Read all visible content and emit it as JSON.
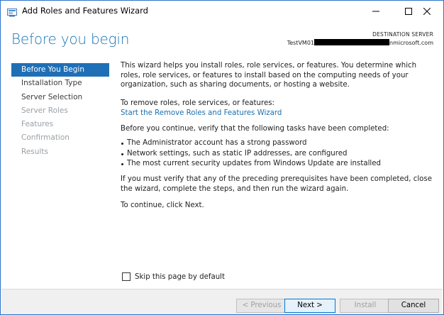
{
  "window": {
    "title": "Add Roles and Features Wizard"
  },
  "header": {
    "heading": "Before you begin",
    "destination_label": "DESTINATION SERVER",
    "destination_server_prefix": "TestVM01",
    "destination_server_suffix": "nmicrosoft.com"
  },
  "nav": {
    "items": [
      {
        "label": "Before You Begin",
        "state": "active"
      },
      {
        "label": "Installation Type",
        "state": "enabled"
      },
      {
        "label": "Server Selection",
        "state": "enabled"
      },
      {
        "label": "Server Roles",
        "state": "disabled"
      },
      {
        "label": "Features",
        "state": "disabled"
      },
      {
        "label": "Confirmation",
        "state": "disabled"
      },
      {
        "label": "Results",
        "state": "disabled"
      }
    ]
  },
  "content": {
    "intro": "This wizard helps you install roles, role services, or features. You determine which roles, role services, or features to install based on the computing needs of your organization, such as sharing documents, or hosting a website.",
    "remove_intro": "To remove roles, role services, or features:",
    "remove_link": "Start the Remove Roles and Features Wizard",
    "verify": "Before you continue, verify that the following tasks have been completed:",
    "bullets": [
      "The Administrator account has a strong password",
      "Network settings, such as static IP addresses, are configured",
      "The most current security updates from Windows Update are installed"
    ],
    "prereq": "If you must verify that any of the preceding prerequisites have been completed, close the wizard, complete the steps, and then run the wizard again.",
    "continue": "To continue, click Next."
  },
  "skip": {
    "label": "Skip this page by default",
    "checked": false
  },
  "footer": {
    "previous": "< Previous",
    "next": "Next >",
    "install": "Install",
    "cancel": "Cancel"
  },
  "colors": {
    "accent": "#1f6fb6",
    "heading": "#1b73b3",
    "link": "#1b6fae",
    "disabled_text": "#9aa0a6"
  }
}
